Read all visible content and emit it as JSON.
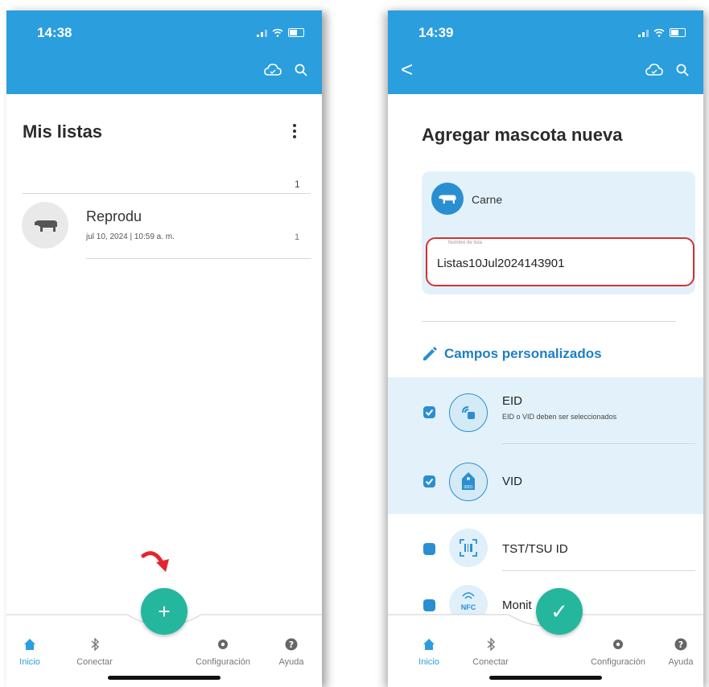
{
  "phone1": {
    "time": "14:38",
    "title": "Mis listas",
    "list_count": "1",
    "item": {
      "name": "Reprodu",
      "date": "jul 10, 2024 | 10:59 a. m.",
      "count": "1"
    },
    "fab_label": "+",
    "nav": [
      "Inicio",
      "Conectar",
      "Configuración",
      "Ayuda"
    ]
  },
  "phone2": {
    "time": "14:39",
    "back": "<",
    "title": "Agregar mascota nueva",
    "species": "Carne",
    "field_label": "Nombre de lista",
    "field_value": "Listas10Jul2024143901",
    "section_title": "Campos personalizados",
    "rows": [
      {
        "label": "EID",
        "sub": "EID o VID deben ser seleccionados"
      },
      {
        "label": "VID",
        "badge": "0001"
      },
      {
        "label": "TST/TSU ID"
      },
      {
        "label": "Monit"
      }
    ],
    "nfc_text": "NFC",
    "fab_label": "✓",
    "nav": [
      "Inicio",
      "Conectar",
      "Configuración",
      "Ayuda"
    ]
  },
  "colors": {
    "primary": "#2b9ede",
    "fab": "#24b79d",
    "highlight": "#d63034",
    "arrow": "#e3262a"
  }
}
